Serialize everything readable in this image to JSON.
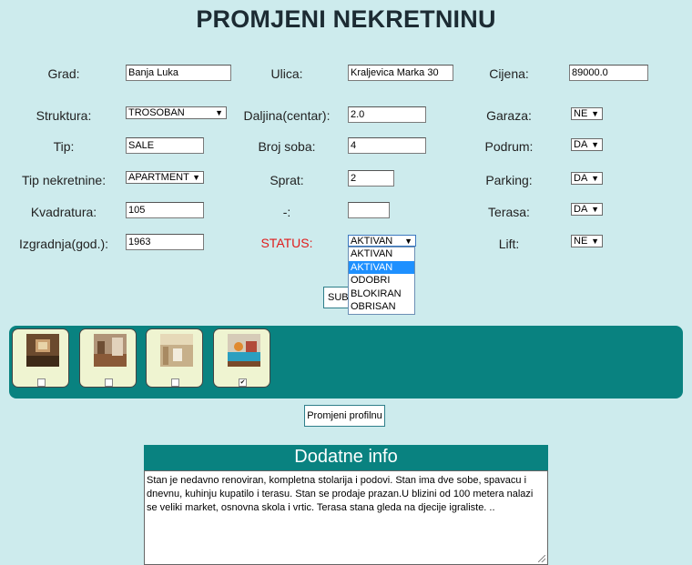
{
  "title": "PROMJENI NEKRETNINU",
  "form": {
    "grad_label": "Grad:",
    "grad_value": "Banja Luka",
    "ulica_label": "Ulica:",
    "ulica_value": "Kraljevica Marka 30",
    "cijena_label": "Cijena:",
    "cijena_value": "89000.0",
    "struktura_label": "Struktura:",
    "struktura_value": "TROSOBAN",
    "daljina_label": "Daljina(centar):",
    "daljina_value": "2.0",
    "garaza_label": "Garaza:",
    "garaza_value": "NE",
    "tip_label": "Tip:",
    "tip_value": "SALE",
    "broj_soba_label": "Broj soba:",
    "broj_soba_value": "4",
    "podrum_label": "Podrum:",
    "podrum_value": "DA",
    "tip_nekretnine_label": "Tip nekretnine:",
    "tip_nekretnine_value": "APARTMENT",
    "sprat_label": "Sprat:",
    "sprat_value": "2",
    "parking_label": "Parking:",
    "parking_value": "DA",
    "kvadratura_label": "Kvadratura:",
    "kvadratura_value": "105",
    "dash_label": "-:",
    "dash_value": "",
    "terasa_label": "Terasa:",
    "terasa_value": "DA",
    "izgradnja_label": "Izgradnja(god.):",
    "izgradnja_value": "1963",
    "status_label": "STATUS:",
    "status_value": "AKTIVAN",
    "lift_label": "Lift:",
    "lift_value": "NE",
    "status_options": [
      "AKTIVAN",
      "AKTIVAN",
      "ODOBRI",
      "BLOKIRAN",
      "OBRISAN"
    ],
    "submit_label": "SUB"
  },
  "gallery": {
    "checked": [
      false,
      false,
      false,
      true
    ]
  },
  "profile_button_label": "Promjeni profilnu",
  "info": {
    "heading": "Dodatne info",
    "text": "Stan je nedavno renoviran, kompletna stolarija i podovi. Stan ima dve sobe, spavacu i dnevnu, kuhinju kupatilo i terasu.  Stan se prodaje prazan.U blizini od 100 metera nalazi se veliki market, osnovna skola i vrtic. Terasa stana gleda na djecije igraliste. .."
  },
  "colors": {
    "background": "#cdebed",
    "teal": "#098280",
    "status_red": "#e01b1b",
    "highlight": "#1e90ff"
  }
}
